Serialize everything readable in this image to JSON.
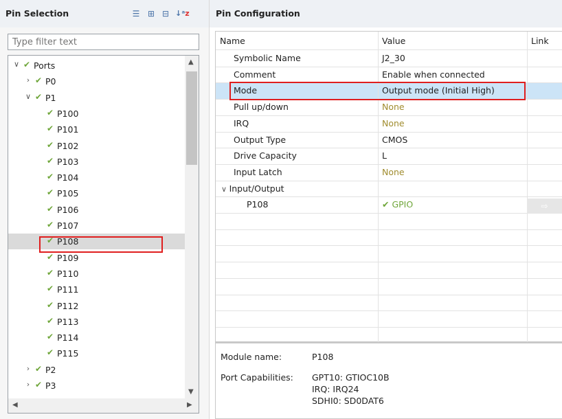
{
  "left_panel": {
    "title": "Pin Selection",
    "filter_placeholder": "Type filter text",
    "tree": [
      {
        "label": "Ports",
        "depth": 0,
        "expanded": true,
        "has_children": true,
        "selected": false
      },
      {
        "label": "P0",
        "depth": 1,
        "expanded": false,
        "has_children": true,
        "selected": false
      },
      {
        "label": "P1",
        "depth": 1,
        "expanded": true,
        "has_children": true,
        "selected": false
      },
      {
        "label": "P100",
        "depth": 2,
        "has_children": false,
        "selected": false
      },
      {
        "label": "P101",
        "depth": 2,
        "has_children": false,
        "selected": false
      },
      {
        "label": "P102",
        "depth": 2,
        "has_children": false,
        "selected": false
      },
      {
        "label": "P103",
        "depth": 2,
        "has_children": false,
        "selected": false
      },
      {
        "label": "P104",
        "depth": 2,
        "has_children": false,
        "selected": false
      },
      {
        "label": "P105",
        "depth": 2,
        "has_children": false,
        "selected": false
      },
      {
        "label": "P106",
        "depth": 2,
        "has_children": false,
        "selected": false
      },
      {
        "label": "P107",
        "depth": 2,
        "has_children": false,
        "selected": false
      },
      {
        "label": "P108",
        "depth": 2,
        "has_children": false,
        "selected": true
      },
      {
        "label": "P109",
        "depth": 2,
        "has_children": false,
        "selected": false
      },
      {
        "label": "P110",
        "depth": 2,
        "has_children": false,
        "selected": false
      },
      {
        "label": "P111",
        "depth": 2,
        "has_children": false,
        "selected": false
      },
      {
        "label": "P112",
        "depth": 2,
        "has_children": false,
        "selected": false
      },
      {
        "label": "P113",
        "depth": 2,
        "has_children": false,
        "selected": false
      },
      {
        "label": "P114",
        "depth": 2,
        "has_children": false,
        "selected": false
      },
      {
        "label": "P115",
        "depth": 2,
        "has_children": false,
        "selected": false
      },
      {
        "label": "P2",
        "depth": 1,
        "expanded": false,
        "has_children": true,
        "selected": false
      },
      {
        "label": "P3",
        "depth": 1,
        "expanded": false,
        "has_children": true,
        "selected": false
      }
    ]
  },
  "right_panel": {
    "title": "Pin Configuration",
    "columns": [
      "Name",
      "Value",
      "Link"
    ],
    "rows": [
      {
        "name": "Symbolic Name",
        "value": "J2_30",
        "value_style": "normal"
      },
      {
        "name": "Comment",
        "value": "Enable when connected",
        "value_style": "normal"
      },
      {
        "name": "Mode",
        "value": "Output mode (Initial High)",
        "value_style": "normal",
        "selected": true
      },
      {
        "name": "Pull up/down",
        "value": "None",
        "value_style": "olive"
      },
      {
        "name": "IRQ",
        "value": "None",
        "value_style": "olive"
      },
      {
        "name": "Output Type",
        "value": "CMOS",
        "value_style": "normal"
      },
      {
        "name": "Drive Capacity",
        "value": "L",
        "value_style": "normal"
      },
      {
        "name": "Input Latch",
        "value": "None",
        "value_style": "olive"
      },
      {
        "name": "Input/Output",
        "value": "",
        "value_style": "normal",
        "group": true
      },
      {
        "name": "P108",
        "value": "GPIO",
        "value_style": "green",
        "indent": true,
        "checked": true
      }
    ],
    "details": {
      "module_label": "Module name:",
      "module_value": "P108",
      "capabilities_label": "Port Capabilities:",
      "capabilities": [
        "GPT10: GTIOC10B",
        "IRQ: IRQ24",
        "SDHI0: SD0DAT6"
      ]
    }
  },
  "colors": {
    "check_green": "#6fa63a",
    "olive_value": "#a08c2e",
    "highlight_red": "#e01e1e",
    "selection_blue": "#cce4f7",
    "selection_gray": "#dadada"
  }
}
